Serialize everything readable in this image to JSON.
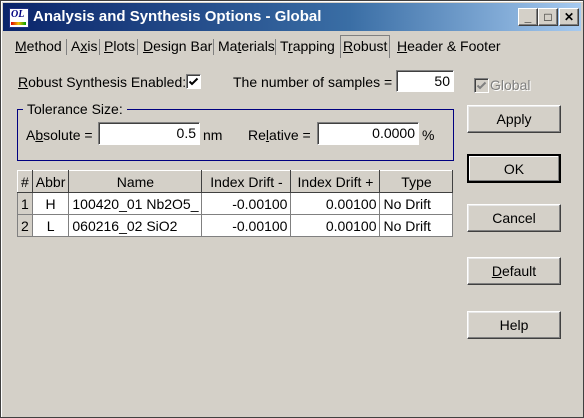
{
  "window": {
    "title": "Analysis and Synthesis Options - Global",
    "app_icon_text": "OL",
    "minimize_glyph": "_",
    "maximize_glyph": "□",
    "close_glyph": "✕"
  },
  "tabs": [
    {
      "label": "Method",
      "selected": false
    },
    {
      "label": "Axis",
      "selected": false
    },
    {
      "label": "Plots",
      "selected": false
    },
    {
      "label": "Design Bar",
      "selected": false
    },
    {
      "label": "Materials",
      "selected": false
    },
    {
      "label": "Trapping",
      "selected": false
    },
    {
      "label": "Robust",
      "selected": true
    },
    {
      "label": "Header & Footer",
      "selected": false
    }
  ],
  "robust": {
    "enabled_label_first": "R",
    "enabled_label_rest": "obust Synthesis Enabled:",
    "enabled": true,
    "samples_label": "The number of samples =",
    "samples_value": "50",
    "global_label": "Global",
    "global_checked": true
  },
  "tolerance": {
    "title": "Tolerance Size:",
    "absolute_prefix": "A",
    "absolute_mid": "b",
    "absolute_rest": "solute =",
    "absolute_value": "0.5",
    "absolute_unit": "nm",
    "relative_prefix": "Re",
    "relative_mid": "l",
    "relative_rest": "ative =",
    "relative_value": "0.0000",
    "relative_unit": "%"
  },
  "buttons": {
    "apply": "Apply",
    "ok": "OK",
    "cancel": "Cancel",
    "default_first": "D",
    "default_rest": "efault",
    "help": "Help"
  },
  "table": {
    "headers": [
      "#",
      "Abbr",
      "Name",
      "Index Drift -",
      "Index Drift +",
      "Type"
    ],
    "rows": [
      {
        "num": "1",
        "abbr": "H",
        "name": "100420_01 Nb2O5_",
        "drift_minus": "-0.00100",
        "drift_plus": "0.00100",
        "type": "No Drift"
      },
      {
        "num": "2",
        "abbr": "L",
        "name": "060216_02 SiO2",
        "drift_minus": "-0.00100",
        "drift_plus": "0.00100",
        "type": "No Drift"
      }
    ]
  }
}
